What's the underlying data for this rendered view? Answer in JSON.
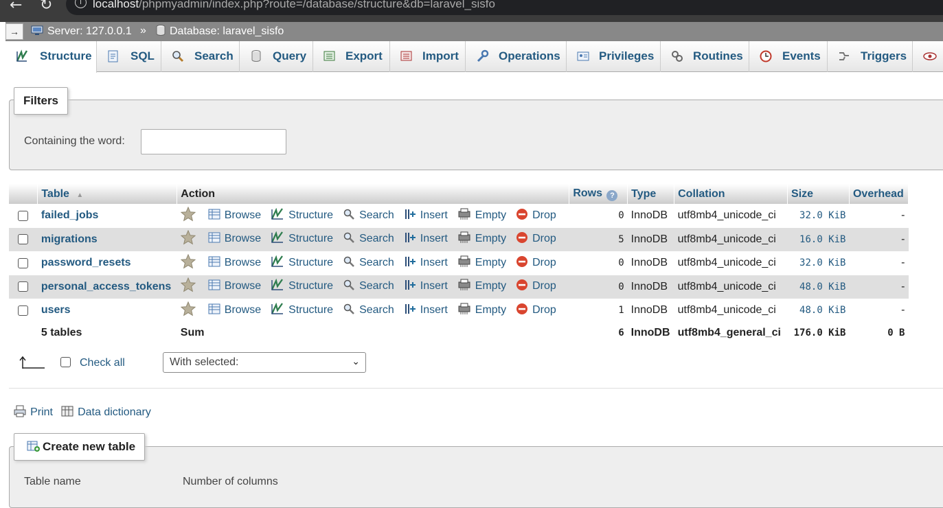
{
  "browser": {
    "back_glyph": "←",
    "reload_glyph": "↻",
    "info_glyph": "i",
    "url_host": "localhost",
    "url_rest": "/phpmyadmin/index.php?route=/database/structure&db=laravel_sisfo"
  },
  "breadcrumb": {
    "collapse_glyph": "→",
    "server": "Server: 127.0.0.1",
    "separator": "»",
    "database": "Database: laravel_sisfo"
  },
  "tabs": [
    {
      "label": "Structure",
      "icon": "structure-icon",
      "active": true
    },
    {
      "label": "SQL",
      "icon": "sql-icon"
    },
    {
      "label": "Search",
      "icon": "search-icon"
    },
    {
      "label": "Query",
      "icon": "query-icon"
    },
    {
      "label": "Export",
      "icon": "export-icon"
    },
    {
      "label": "Import",
      "icon": "import-icon"
    },
    {
      "label": "Operations",
      "icon": "wrench-icon"
    },
    {
      "label": "Privileges",
      "icon": "privileges-icon"
    },
    {
      "label": "Routines",
      "icon": "routines-icon"
    },
    {
      "label": "Events",
      "icon": "clock-icon"
    },
    {
      "label": "Triggers",
      "icon": "triggers-icon"
    },
    {
      "label": "",
      "icon": "eye-icon"
    }
  ],
  "filters": {
    "legend": "Filters",
    "containing_label": "Containing the word:",
    "containing_value": ""
  },
  "table": {
    "headers": {
      "table": "Table",
      "action": "Action",
      "rows": "Rows",
      "type": "Type",
      "collation": "Collation",
      "size": "Size",
      "overhead": "Overhead"
    },
    "actions": {
      "browse": "Browse",
      "structure": "Structure",
      "search": "Search",
      "insert": "Insert",
      "empty": "Empty",
      "drop": "Drop"
    },
    "rows": [
      {
        "name": "failed_jobs",
        "rows": "0",
        "type": "InnoDB",
        "collation": "utf8mb4_unicode_ci",
        "size": "32.0 KiB",
        "overhead": "-"
      },
      {
        "name": "migrations",
        "rows": "5",
        "type": "InnoDB",
        "collation": "utf8mb4_unicode_ci",
        "size": "16.0 KiB",
        "overhead": "-"
      },
      {
        "name": "password_resets",
        "rows": "0",
        "type": "InnoDB",
        "collation": "utf8mb4_unicode_ci",
        "size": "32.0 KiB",
        "overhead": "-"
      },
      {
        "name": "personal_access_tokens",
        "rows": "0",
        "type": "InnoDB",
        "collation": "utf8mb4_unicode_ci",
        "size": "48.0 KiB",
        "overhead": "-"
      },
      {
        "name": "users",
        "rows": "1",
        "type": "InnoDB",
        "collation": "utf8mb4_unicode_ci",
        "size": "48.0 KiB",
        "overhead": "-"
      }
    ],
    "summary": {
      "count": "5 tables",
      "label": "Sum",
      "rows": "6",
      "type": "InnoDB",
      "collation": "utf8mb4_general_ci",
      "size": "176.0 KiB",
      "overhead": "0 B"
    }
  },
  "bulk": {
    "check_all": "Check all",
    "with_selected": "With selected:"
  },
  "links": {
    "print": "Print",
    "data_dictionary": "Data dictionary"
  },
  "create": {
    "legend": "Create new table",
    "table_name_label": "Table name",
    "num_columns_label": "Number of columns"
  },
  "colors": {
    "link": "#235a81",
    "breadcrumb_bg": "#888888",
    "row_even": "#dfdfdf",
    "drop_red": "#d9452f"
  }
}
